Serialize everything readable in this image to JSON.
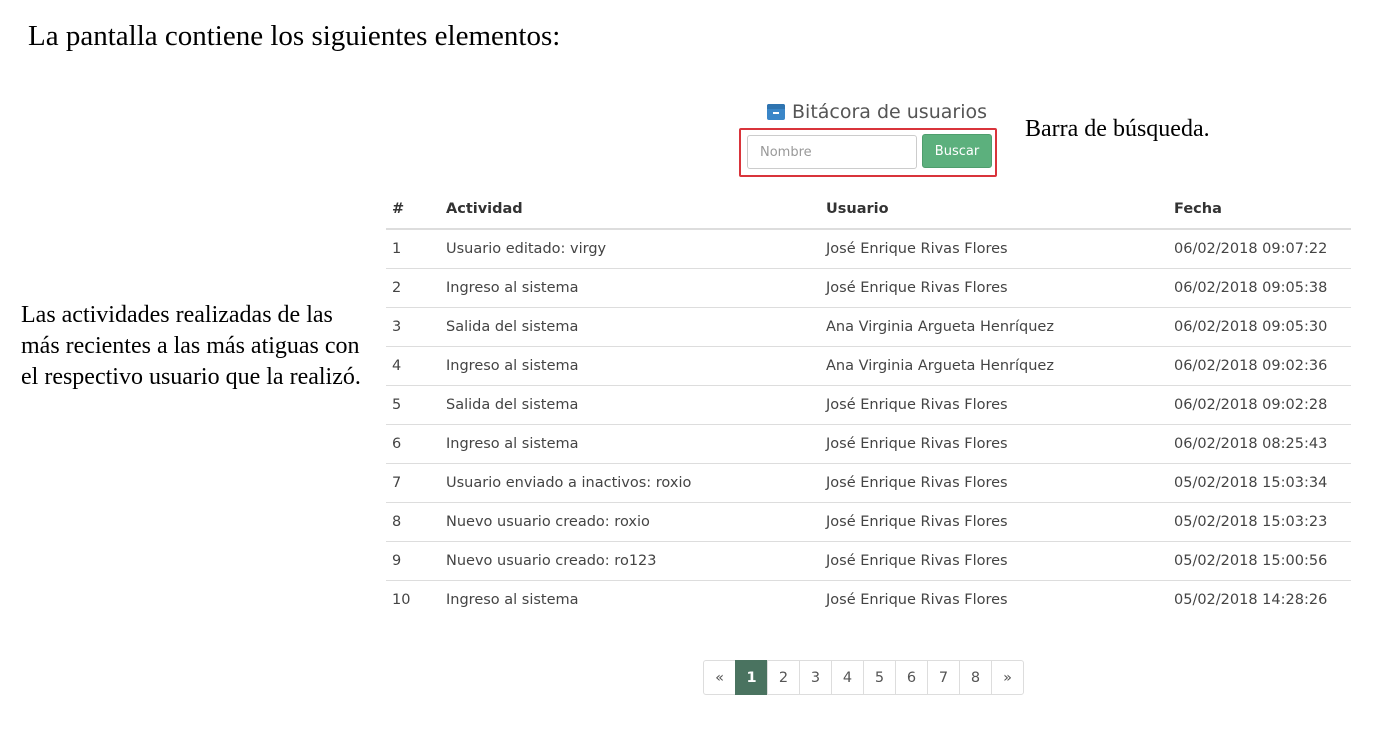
{
  "annotations": {
    "intro": "La pantalla contiene los siguientes elementos:",
    "search_label": "Barra de búsqueda.",
    "activities_label": "Las actividades realizadas de las más recientes a las más atiguas con el respectivo usuario que la realizó."
  },
  "panel": {
    "title": "Bitácora de usuarios",
    "title_icon": "archive-icon",
    "accent_color": "#3a86c8"
  },
  "search": {
    "placeholder": "Nombre",
    "value": "",
    "button_label": "Buscar",
    "button_color": "#5cb07d",
    "highlight_color": "#d9343b"
  },
  "table": {
    "headers": {
      "num": "#",
      "activity": "Actividad",
      "user": "Usuario",
      "date": "Fecha"
    },
    "rows": [
      {
        "num": "1",
        "activity": "Usuario editado: virgy",
        "user": "José Enrique Rivas Flores",
        "date": "06/02/2018 09:07:22"
      },
      {
        "num": "2",
        "activity": "Ingreso al sistema",
        "user": "José Enrique Rivas Flores",
        "date": "06/02/2018 09:05:38"
      },
      {
        "num": "3",
        "activity": "Salida del sistema",
        "user": "Ana Virginia Argueta Henríquez",
        "date": "06/02/2018 09:05:30"
      },
      {
        "num": "4",
        "activity": "Ingreso al sistema",
        "user": "Ana Virginia Argueta Henríquez",
        "date": "06/02/2018 09:02:36"
      },
      {
        "num": "5",
        "activity": "Salida del sistema",
        "user": "José Enrique Rivas Flores",
        "date": "06/02/2018 09:02:28"
      },
      {
        "num": "6",
        "activity": "Ingreso al sistema",
        "user": "José Enrique Rivas Flores",
        "date": "06/02/2018 08:25:43"
      },
      {
        "num": "7",
        "activity": "Usuario enviado a inactivos: roxio",
        "user": "José Enrique Rivas Flores",
        "date": "05/02/2018 15:03:34"
      },
      {
        "num": "8",
        "activity": "Nuevo usuario creado: roxio",
        "user": "José Enrique Rivas Flores",
        "date": "05/02/2018 15:03:23"
      },
      {
        "num": "9",
        "activity": "Nuevo usuario creado: ro123",
        "user": "José Enrique Rivas Flores",
        "date": "05/02/2018 15:00:56"
      },
      {
        "num": "10",
        "activity": "Ingreso al sistema",
        "user": "José Enrique Rivas Flores",
        "date": "05/02/2018 14:28:26"
      }
    ]
  },
  "pagination": {
    "prev_label": "«",
    "next_label": "»",
    "pages": [
      "1",
      "2",
      "3",
      "4",
      "5",
      "6",
      "7",
      "8"
    ],
    "current": "1",
    "active_color": "#4a7360"
  }
}
